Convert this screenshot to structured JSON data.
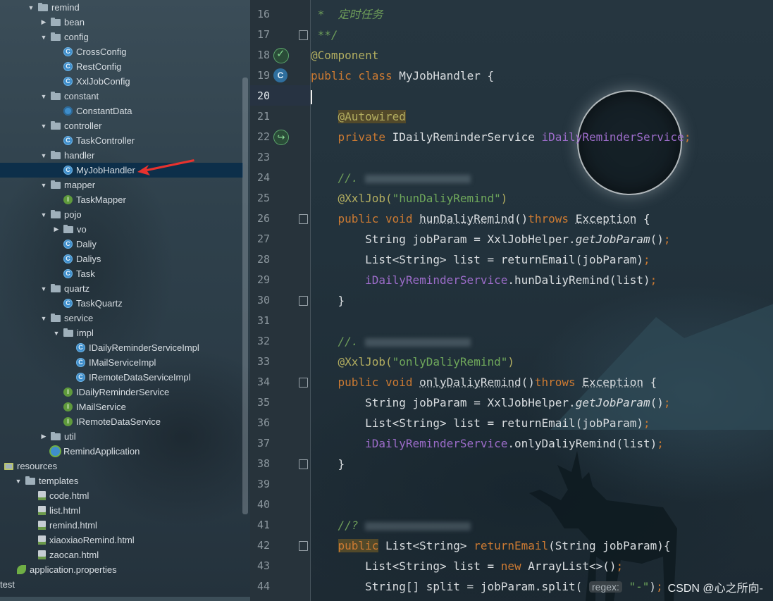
{
  "tree": {
    "items": [
      {
        "label": "remind",
        "icon": "folder",
        "depth": 2,
        "arrow": "down"
      },
      {
        "label": "bean",
        "icon": "folder",
        "depth": 3,
        "arrow": "right"
      },
      {
        "label": "config",
        "icon": "folder",
        "depth": 3,
        "arrow": "down"
      },
      {
        "label": "CrossConfig",
        "icon": "class",
        "depth": 4,
        "arrow": ""
      },
      {
        "label": "RestConfig",
        "icon": "class",
        "depth": 4,
        "arrow": ""
      },
      {
        "label": "XxlJobConfig",
        "icon": "class",
        "depth": 4,
        "arrow": ""
      },
      {
        "label": "constant",
        "icon": "folder",
        "depth": 3,
        "arrow": "down"
      },
      {
        "label": "ConstantData",
        "icon": "enum",
        "depth": 4,
        "arrow": ""
      },
      {
        "label": "controller",
        "icon": "folder",
        "depth": 3,
        "arrow": "down"
      },
      {
        "label": "TaskController",
        "icon": "class",
        "depth": 4,
        "arrow": ""
      },
      {
        "label": "handler",
        "icon": "folder",
        "depth": 3,
        "arrow": "down"
      },
      {
        "label": "MyJobHandler",
        "icon": "class",
        "depth": 4,
        "arrow": "",
        "selected": true
      },
      {
        "label": "mapper",
        "icon": "folder",
        "depth": 3,
        "arrow": "down"
      },
      {
        "label": "TaskMapper",
        "icon": "iface",
        "depth": 4,
        "arrow": ""
      },
      {
        "label": "pojo",
        "icon": "folder",
        "depth": 3,
        "arrow": "down"
      },
      {
        "label": "vo",
        "icon": "folder",
        "depth": 4,
        "arrow": "right"
      },
      {
        "label": "Daliy",
        "icon": "class",
        "depth": 4,
        "arrow": ""
      },
      {
        "label": "Daliys",
        "icon": "class",
        "depth": 4,
        "arrow": ""
      },
      {
        "label": "Task",
        "icon": "class",
        "depth": 4,
        "arrow": ""
      },
      {
        "label": "quartz",
        "icon": "folder",
        "depth": 3,
        "arrow": "down"
      },
      {
        "label": "TaskQuartz",
        "icon": "class",
        "depth": 4,
        "arrow": ""
      },
      {
        "label": "service",
        "icon": "folder",
        "depth": 3,
        "arrow": "down"
      },
      {
        "label": "impl",
        "icon": "folder",
        "depth": 4,
        "arrow": "down"
      },
      {
        "label": "IDailyReminderServiceImpl",
        "icon": "class",
        "depth": 5,
        "arrow": ""
      },
      {
        "label": "IMailServiceImpl",
        "icon": "class",
        "depth": 5,
        "arrow": ""
      },
      {
        "label": "IRemoteDataServiceImpl",
        "icon": "class",
        "depth": 5,
        "arrow": ""
      },
      {
        "label": "IDailyReminderService",
        "icon": "iface",
        "depth": 4,
        "arrow": ""
      },
      {
        "label": "IMailService",
        "icon": "iface",
        "depth": 4,
        "arrow": ""
      },
      {
        "label": "IRemoteDataService",
        "icon": "iface",
        "depth": 4,
        "arrow": ""
      },
      {
        "label": "util",
        "icon": "folder",
        "depth": 3,
        "arrow": "right"
      },
      {
        "label": "RemindApplication",
        "icon": "app",
        "depth": 3,
        "arrow": ""
      },
      {
        "label": "resources",
        "icon": "res",
        "depth": 0,
        "arrow": ""
      },
      {
        "label": "templates",
        "icon": "folder",
        "depth": 1,
        "arrow": "down"
      },
      {
        "label": "code.html",
        "icon": "html",
        "depth": 2,
        "arrow": ""
      },
      {
        "label": "list.html",
        "icon": "html",
        "depth": 2,
        "arrow": ""
      },
      {
        "label": "remind.html",
        "icon": "html",
        "depth": 2,
        "arrow": ""
      },
      {
        "label": "xiaoxiaoRemind.html",
        "icon": "html",
        "depth": 2,
        "arrow": ""
      },
      {
        "label": "zaocan.html",
        "icon": "html",
        "depth": 2,
        "arrow": ""
      },
      {
        "label": "application.properties",
        "icon": "leaf",
        "depth": 1,
        "arrow": ""
      },
      {
        "label": "test",
        "icon": "",
        "depth": -1,
        "arrow": ""
      }
    ]
  },
  "editor": {
    "current_line": 20,
    "lines": [
      {
        "n": 16,
        "html": "<span class='cmt'> *  定时任务</span>"
      },
      {
        "n": 17,
        "html": "<span class='cmt'> **/</span>"
      },
      {
        "n": 18,
        "html": "<span class='ann'>@Component</span>"
      },
      {
        "n": 19,
        "html": "<span class='kw'>public class </span>MyJobHandler {"
      },
      {
        "n": 20,
        "html": "<span class='caret'></span>"
      },
      {
        "n": 21,
        "html": "    <span class='ann hl'>@Autowired</span>"
      },
      {
        "n": 22,
        "html": "    <span class='kw'>private </span>IDailyReminderService <span class='fld'>iDailyReminderService</span><span class='kw'>;</span>"
      },
      {
        "n": 23,
        "html": ""
      },
      {
        "n": 24,
        "html": "    <span class='cmt'>//. </span><span class='blur'></span>"
      },
      {
        "n": 25,
        "html": "    <span class='ann'>@XxlJob(</span><span class='str'>\"hunDaliyRemind\"</span><span class='ann'>)</span>"
      },
      {
        "n": 26,
        "html": "    <span class='kw'>public void </span><span class='wavy'>hunDaliyRemind</span>()<span class='kw'>throws </span><span class='wavy'>Exception</span> {"
      },
      {
        "n": 27,
        "html": "        String jobParam = XxlJobHelper.<span class='ital'>getJobParam</span>()<span class='kw'>;</span>"
      },
      {
        "n": 28,
        "html": "        List&lt;String&gt; list = returnEmail(jobParam)<span class='kw'>;</span>"
      },
      {
        "n": 29,
        "html": "        <span class='fld'>iDailyReminderService</span>.hunDaliyRemind(list)<span class='kw'>;</span>"
      },
      {
        "n": 30,
        "html": "    }"
      },
      {
        "n": 31,
        "html": ""
      },
      {
        "n": 32,
        "html": "    <span class='cmt'>//. </span><span class='blur'></span>"
      },
      {
        "n": 33,
        "html": "    <span class='ann'>@XxlJob(</span><span class='str'>\"onlyDaliyRemind\"</span><span class='ann'>)</span>"
      },
      {
        "n": 34,
        "html": "    <span class='kw'>public void </span><span class='wavy'>onlyDaliyRemind</span>()<span class='kw'>throws </span><span class='wavy'>Exception</span> {"
      },
      {
        "n": 35,
        "html": "        String jobParam = XxlJobHelper.<span class='ital'>getJobParam</span>()<span class='kw'>;</span>"
      },
      {
        "n": 36,
        "html": "        List&lt;String&gt; list = returnEmail(jobParam)<span class='kw'>;</span>"
      },
      {
        "n": 37,
        "html": "        <span class='fld'>iDailyReminderService</span>.onlyDaliyRemind(list)<span class='kw'>;</span>"
      },
      {
        "n": 38,
        "html": "    }"
      },
      {
        "n": 39,
        "html": ""
      },
      {
        "n": 40,
        "html": ""
      },
      {
        "n": 41,
        "html": "    <span class='cmt'>//? </span><span class='blur'></span>"
      },
      {
        "n": 42,
        "html": "    <span class='kw hl'>public</span> List&lt;String&gt; <span class='kw'>returnEmail</span>(String jobParam){"
      },
      {
        "n": 43,
        "html": "        List&lt;String&gt; list = <span class='kw'>new </span>ArrayList&lt;&gt;()<span class='kw'>;</span>"
      },
      {
        "n": 44,
        "html": "        String[] split = jobParam.split( <span class='hint'>regex:</span> <span class='str'>\"-\"</span>)<span class='kw'>;</span>"
      }
    ]
  },
  "watermark": "CSDN @心之所向-",
  "colors": {
    "accent": "#1d2e8a",
    "keyword": "#cc7a32",
    "annotation": "#b3ae60",
    "string": "#6fa85b",
    "field": "#9c6cc9"
  }
}
